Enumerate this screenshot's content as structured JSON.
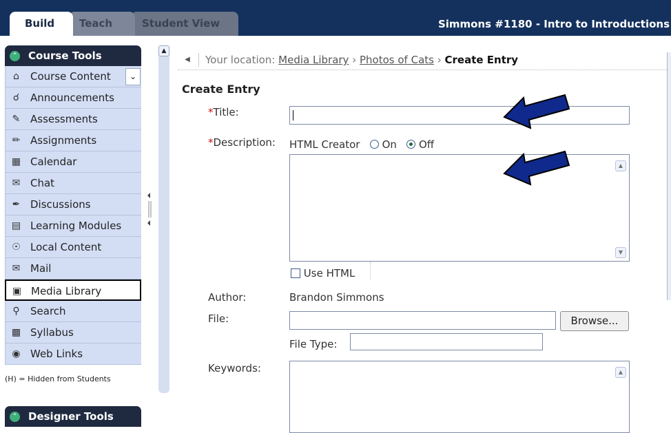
{
  "tabs": {
    "build": "Build",
    "teach": "Teach",
    "student_view": "Student View"
  },
  "course_title": "Simmons #1180 - Intro to Introductions",
  "sidebar": {
    "course_tools_title": "Course Tools",
    "items": [
      {
        "label": "Course Content",
        "icon": "house-icon"
      },
      {
        "label": "Announcements",
        "icon": "megaphone-icon"
      },
      {
        "label": "Assessments",
        "icon": "assessment-icon"
      },
      {
        "label": "Assignments",
        "icon": "assignment-icon"
      },
      {
        "label": "Calendar",
        "icon": "calendar-icon"
      },
      {
        "label": "Chat",
        "icon": "chat-icon"
      },
      {
        "label": "Discussions",
        "icon": "pin-icon"
      },
      {
        "label": "Learning Modules",
        "icon": "module-icon"
      },
      {
        "label": "Local Content",
        "icon": "disc-icon"
      },
      {
        "label": "Mail",
        "icon": "mail-icon"
      },
      {
        "label": "Media Library",
        "icon": "media-icon"
      },
      {
        "label": "Search",
        "icon": "search-icon"
      },
      {
        "label": "Syllabus",
        "icon": "syllabus-icon"
      },
      {
        "label": "Web Links",
        "icon": "globe-icon"
      }
    ],
    "note": "(H) = Hidden from Students",
    "designer_tools_title": "Designer Tools"
  },
  "breadcrumb": {
    "prefix": "Your location:",
    "media_library": "Media Library",
    "photos": "Photos of Cats",
    "current": "Create Entry"
  },
  "form": {
    "heading": "Create Entry",
    "required_mark": "*",
    "title_label": "Title:",
    "title_value": "",
    "description_label": "Description:",
    "html_creator_label": "HTML Creator",
    "on_label": "On",
    "off_label": "Off",
    "html_creator_selected": "Off",
    "description_value": "",
    "use_html_label": "Use HTML",
    "author_label": "Author:",
    "author_value": "Brandon Simmons",
    "file_label": "File:",
    "file_value": "",
    "browse_label": "Browse...",
    "file_type_label": "File Type:",
    "file_type_value": "",
    "keywords_label": "Keywords:",
    "keywords_value": ""
  },
  "colors": {
    "topbar": "#14315e",
    "nav_bg": "#d3def5",
    "section_head": "#1f2a40",
    "arrow_fill": "#0f2a8c",
    "required": "#cc1111"
  }
}
